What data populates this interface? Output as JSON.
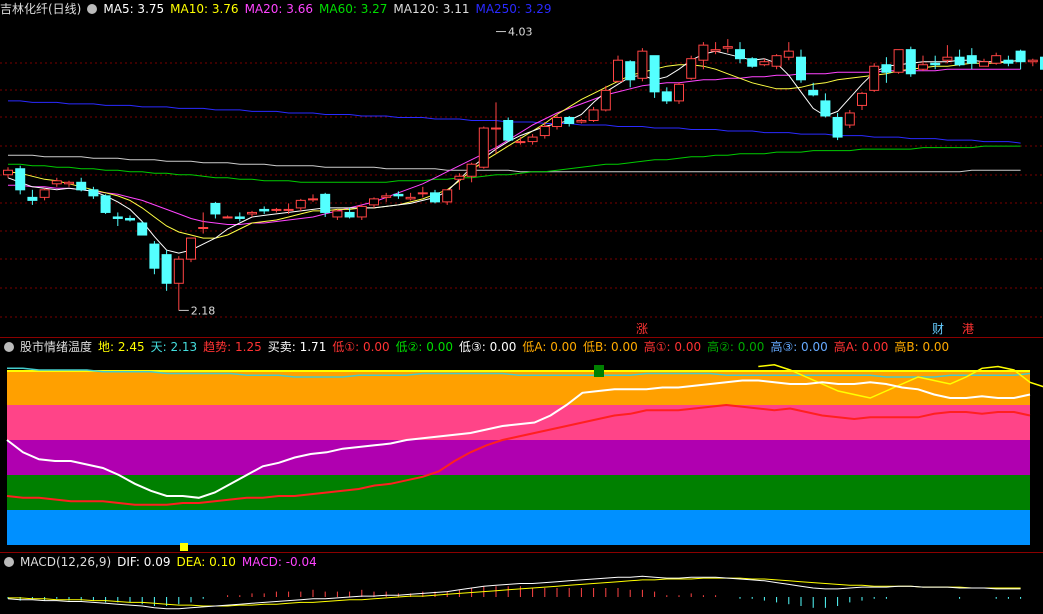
{
  "main": {
    "title": "吉林化纤(日线)",
    "ma": [
      {
        "label": "MA5: 3.75",
        "color": "#ffffff"
      },
      {
        "label": "MA10: 3.76",
        "color": "#ffff00"
      },
      {
        "label": "MA20: 3.66",
        "color": "#ff44ff"
      },
      {
        "label": "MA60: 3.27",
        "color": "#00dd00"
      },
      {
        "label": "MA120: 3.11",
        "color": "#dddddd"
      },
      {
        "label": "MA250: 3.29",
        "color": "#2a2aff"
      }
    ],
    "high_label": "4.03",
    "low_label": "2.18",
    "markers": [
      {
        "text": "涨",
        "color": "#ff3333"
      },
      {
        "text": "财",
        "color": "#66ccff"
      },
      {
        "text": "港",
        "color": "#ff3333"
      }
    ],
    "candles": [
      [
        3.08,
        3.13,
        3.06,
        3.11
      ],
      [
        3.12,
        3.14,
        2.95,
        2.98
      ],
      [
        2.93,
        2.98,
        2.88,
        2.91
      ],
      [
        2.93,
        2.99,
        2.91,
        2.98
      ],
      [
        3.02,
        3.06,
        3.0,
        3.04
      ],
      [
        3.02,
        3.04,
        3.0,
        3.03
      ],
      [
        3.03,
        3.06,
        2.97,
        2.98
      ],
      [
        2.98,
        3.0,
        2.92,
        2.94
      ],
      [
        2.94,
        2.95,
        2.82,
        2.83
      ],
      [
        2.8,
        2.83,
        2.74,
        2.79
      ],
      [
        2.79,
        2.81,
        2.77,
        2.78
      ],
      [
        2.76,
        2.77,
        2.68,
        2.68
      ],
      [
        2.62,
        2.64,
        2.42,
        2.46
      ],
      [
        2.55,
        2.58,
        2.31,
        2.36
      ],
      [
        2.36,
        2.54,
        2.18,
        2.52
      ],
      [
        2.52,
        2.66,
        2.5,
        2.66
      ],
      [
        2.73,
        2.83,
        2.69,
        2.73
      ],
      [
        2.89,
        2.9,
        2.79,
        2.82
      ],
      [
        2.8,
        2.81,
        2.79,
        2.8
      ],
      [
        2.8,
        2.83,
        2.77,
        2.79
      ],
      [
        2.82,
        2.84,
        2.8,
        2.83
      ],
      [
        2.85,
        2.87,
        2.82,
        2.84
      ],
      [
        2.85,
        2.86,
        2.83,
        2.85
      ],
      [
        2.85,
        2.89,
        2.82,
        2.85
      ],
      [
        2.86,
        2.92,
        2.84,
        2.91
      ],
      [
        2.92,
        2.95,
        2.9,
        2.92
      ],
      [
        2.95,
        2.96,
        2.8,
        2.83
      ],
      [
        2.8,
        2.85,
        2.78,
        2.84
      ],
      [
        2.83,
        2.86,
        2.79,
        2.8
      ],
      [
        2.8,
        2.88,
        2.78,
        2.87
      ],
      [
        2.88,
        2.93,
        2.86,
        2.92
      ],
      [
        2.93,
        2.96,
        2.9,
        2.94
      ],
      [
        2.95,
        2.97,
        2.92,
        2.94
      ],
      [
        2.92,
        2.96,
        2.91,
        2.93
      ],
      [
        2.96,
        3.0,
        2.93,
        2.96
      ],
      [
        2.96,
        2.98,
        2.89,
        2.9
      ],
      [
        2.9,
        2.98,
        2.88,
        2.98
      ],
      [
        3.05,
        3.09,
        2.98,
        3.07
      ],
      [
        3.07,
        3.16,
        3.03,
        3.15
      ],
      [
        3.13,
        3.4,
        3.12,
        3.39
      ],
      [
        3.39,
        3.56,
        3.22,
        3.39
      ],
      [
        3.44,
        3.46,
        3.3,
        3.31
      ],
      [
        3.3,
        3.33,
        3.28,
        3.3
      ],
      [
        3.3,
        3.35,
        3.28,
        3.33
      ],
      [
        3.34,
        3.43,
        3.32,
        3.4
      ],
      [
        3.4,
        3.48,
        3.38,
        3.46
      ],
      [
        3.46,
        3.47,
        3.4,
        3.42
      ],
      [
        3.43,
        3.45,
        3.42,
        3.44
      ],
      [
        3.44,
        3.53,
        3.43,
        3.51
      ],
      [
        3.51,
        3.67,
        3.5,
        3.64
      ],
      [
        3.7,
        3.87,
        3.69,
        3.84
      ],
      [
        3.83,
        3.84,
        3.66,
        3.71
      ],
      [
        3.72,
        3.92,
        3.7,
        3.9
      ],
      [
        3.87,
        3.87,
        3.59,
        3.63
      ],
      [
        3.63,
        3.66,
        3.55,
        3.57
      ],
      [
        3.57,
        3.69,
        3.55,
        3.68
      ],
      [
        3.72,
        3.87,
        3.71,
        3.85
      ],
      [
        3.84,
        3.96,
        3.78,
        3.94
      ],
      [
        3.9,
        3.96,
        3.88,
        3.91
      ],
      [
        3.92,
        3.98,
        3.89,
        3.93
      ],
      [
        3.91,
        3.96,
        3.82,
        3.85
      ],
      [
        3.85,
        3.86,
        3.79,
        3.8
      ],
      [
        3.81,
        3.85,
        3.8,
        3.83
      ],
      [
        3.8,
        3.88,
        3.78,
        3.87
      ],
      [
        3.86,
        3.96,
        3.84,
        3.9
      ],
      [
        3.86,
        3.91,
        3.69,
        3.71
      ],
      [
        3.64,
        3.69,
        3.6,
        3.61
      ],
      [
        3.57,
        3.62,
        3.46,
        3.47
      ],
      [
        3.46,
        3.49,
        3.31,
        3.33
      ],
      [
        3.41,
        3.51,
        3.39,
        3.49
      ],
      [
        3.54,
        3.63,
        3.51,
        3.62
      ],
      [
        3.64,
        3.82,
        3.63,
        3.8
      ],
      [
        3.81,
        3.86,
        3.69,
        3.76
      ],
      [
        3.76,
        3.91,
        3.75,
        3.91
      ],
      [
        3.91,
        3.93,
        3.73,
        3.75
      ],
      [
        3.78,
        3.87,
        3.77,
        3.81
      ],
      [
        3.82,
        3.87,
        3.78,
        3.81
      ],
      [
        3.84,
        3.94,
        3.82,
        3.86
      ],
      [
        3.86,
        3.91,
        3.8,
        3.81
      ],
      [
        3.87,
        3.92,
        3.78,
        3.82
      ],
      [
        3.8,
        3.85,
        3.8,
        3.83
      ],
      [
        3.82,
        3.89,
        3.81,
        3.87
      ],
      [
        3.84,
        3.87,
        3.8,
        3.82
      ],
      [
        3.9,
        3.91,
        3.78,
        3.83
      ],
      [
        3.83,
        3.85,
        3.8,
        3.84
      ],
      [
        3.86,
        3.86,
        3.71,
        3.78
      ]
    ],
    "ma5": [
      3.06,
      3.03,
      3.0,
      2.99,
      2.98,
      2.99,
      2.98,
      2.97,
      2.94,
      2.9,
      2.85,
      2.77,
      2.67,
      2.58,
      2.56,
      2.58,
      2.62,
      2.66,
      2.72,
      2.76,
      2.8,
      2.81,
      2.82,
      2.83,
      2.84,
      2.85,
      2.86,
      2.86,
      2.86,
      2.86,
      2.86,
      2.87,
      2.88,
      2.89,
      2.91,
      2.93,
      2.97,
      3.05,
      3.13,
      3.19,
      3.25,
      3.3,
      3.34,
      3.37,
      3.4,
      3.42,
      3.44,
      3.48,
      3.56,
      3.63,
      3.68,
      3.73,
      3.74,
      3.71,
      3.73,
      3.78,
      3.84,
      3.88,
      3.9,
      3.88,
      3.86,
      3.84,
      3.85,
      3.82,
      3.74,
      3.63,
      3.52,
      3.47,
      3.5,
      3.59,
      3.68,
      3.76,
      3.8,
      3.81,
      3.82,
      3.83,
      3.83,
      3.83,
      3.84,
      3.84,
      3.83,
      3.83,
      3.83,
      3.84
    ],
    "ma10": [
      3.1,
      3.09,
      3.07,
      3.05,
      3.04,
      3.02,
      3.0,
      2.98,
      2.96,
      2.94,
      2.91,
      2.86,
      2.8,
      2.74,
      2.7,
      2.68,
      2.66,
      2.66,
      2.68,
      2.72,
      2.76,
      2.77,
      2.78,
      2.8,
      2.82,
      2.84,
      2.84,
      2.85,
      2.85,
      2.86,
      2.86,
      2.87,
      2.88,
      2.9,
      2.92,
      2.95,
      2.98,
      3.04,
      3.11,
      3.17,
      3.22,
      3.27,
      3.32,
      3.37,
      3.42,
      3.48,
      3.53,
      3.58,
      3.62,
      3.66,
      3.7,
      3.74,
      3.76,
      3.78,
      3.8,
      3.81,
      3.81,
      3.8,
      3.78,
      3.75,
      3.72,
      3.69,
      3.67,
      3.65,
      3.65,
      3.66,
      3.68,
      3.69,
      3.71,
      3.72,
      3.73,
      3.74,
      3.75,
      3.77,
      3.78,
      3.79,
      3.8,
      3.8,
      3.81,
      3.82,
      3.82,
      3.82,
      3.83,
      3.84
    ],
    "ma20": [
      3.01,
      3.01,
      3.0,
      3.0,
      2.99,
      2.99,
      2.98,
      2.97,
      2.96,
      2.95,
      2.93,
      2.91,
      2.88,
      2.85,
      2.82,
      2.79,
      2.77,
      2.76,
      2.75,
      2.75,
      2.76,
      2.76,
      2.77,
      2.78,
      2.79,
      2.8,
      2.82,
      2.84,
      2.86,
      2.88,
      2.9,
      2.93,
      2.96,
      2.99,
      3.02,
      3.06,
      3.1,
      3.14,
      3.18,
      3.22,
      3.26,
      3.31,
      3.36,
      3.41,
      3.45,
      3.49,
      3.52,
      3.55,
      3.58,
      3.61,
      3.63,
      3.65,
      3.67,
      3.68,
      3.69,
      3.69,
      3.7,
      3.71,
      3.71,
      3.72,
      3.72,
      3.73,
      3.73,
      3.74,
      3.74,
      3.75,
      3.75,
      3.75,
      3.76,
      3.76,
      3.76,
      3.76,
      3.77,
      3.77,
      3.77,
      3.77,
      3.77,
      3.78,
      3.78,
      3.78,
      3.78,
      3.78,
      3.78,
      3.78
    ],
    "ma60": [
      3.15,
      3.15,
      3.14,
      3.14,
      3.13,
      3.13,
      3.12,
      3.12,
      3.11,
      3.11,
      3.1,
      3.1,
      3.09,
      3.09,
      3.08,
      3.08,
      3.07,
      3.06,
      3.06,
      3.05,
      3.05,
      3.04,
      3.04,
      3.04,
      3.03,
      3.03,
      3.03,
      3.03,
      3.03,
      3.03,
      3.03,
      3.03,
      3.04,
      3.04,
      3.04,
      3.05,
      3.05,
      3.06,
      3.06,
      3.07,
      3.08,
      3.08,
      3.09,
      3.1,
      3.1,
      3.11,
      3.12,
      3.13,
      3.14,
      3.15,
      3.15,
      3.16,
      3.17,
      3.18,
      3.18,
      3.19,
      3.2,
      3.2,
      3.21,
      3.21,
      3.22,
      3.22,
      3.22,
      3.23,
      3.23,
      3.23,
      3.24,
      3.24,
      3.24,
      3.24,
      3.25,
      3.25,
      3.25,
      3.25,
      3.25,
      3.26,
      3.26,
      3.26,
      3.26,
      3.26,
      3.27,
      3.27,
      3.27,
      3.27
    ],
    "ma120": [
      3.21,
      3.21,
      3.21,
      3.2,
      3.2,
      3.2,
      3.2,
      3.19,
      3.19,
      3.19,
      3.18,
      3.18,
      3.18,
      3.17,
      3.17,
      3.17,
      3.16,
      3.16,
      3.16,
      3.15,
      3.15,
      3.15,
      3.14,
      3.14,
      3.14,
      3.14,
      3.13,
      3.13,
      3.13,
      3.13,
      3.13,
      3.12,
      3.12,
      3.12,
      3.12,
      3.12,
      3.11,
      3.11,
      3.11,
      3.11,
      3.11,
      3.11,
      3.1,
      3.1,
      3.1,
      3.1,
      3.1,
      3.1,
      3.1,
      3.1,
      3.1,
      3.1,
      3.1,
      3.1,
      3.1,
      3.1,
      3.1,
      3.1,
      3.1,
      3.1,
      3.1,
      3.1,
      3.1,
      3.1,
      3.1,
      3.1,
      3.1,
      3.1,
      3.1,
      3.1,
      3.1,
      3.1,
      3.1,
      3.1,
      3.1,
      3.1,
      3.1,
      3.1,
      3.1,
      3.11,
      3.11,
      3.11,
      3.11,
      3.11
    ],
    "ma250": [
      3.57,
      3.57,
      3.56,
      3.56,
      3.56,
      3.55,
      3.55,
      3.55,
      3.54,
      3.54,
      3.54,
      3.53,
      3.53,
      3.53,
      3.52,
      3.52,
      3.52,
      3.51,
      3.51,
      3.51,
      3.5,
      3.5,
      3.5,
      3.49,
      3.49,
      3.49,
      3.48,
      3.48,
      3.48,
      3.47,
      3.47,
      3.47,
      3.46,
      3.46,
      3.46,
      3.45,
      3.45,
      3.45,
      3.44,
      3.44,
      3.44,
      3.43,
      3.43,
      3.43,
      3.42,
      3.42,
      3.42,
      3.41,
      3.41,
      3.41,
      3.4,
      3.4,
      3.4,
      3.39,
      3.39,
      3.39,
      3.38,
      3.38,
      3.38,
      3.37,
      3.37,
      3.37,
      3.36,
      3.36,
      3.36,
      3.35,
      3.35,
      3.35,
      3.34,
      3.34,
      3.34,
      3.33,
      3.33,
      3.33,
      3.32,
      3.32,
      3.32,
      3.31,
      3.31,
      3.31,
      3.3,
      3.3,
      3.3,
      3.29
    ]
  },
  "sentiment": {
    "title": "股市情绪温度",
    "values": [
      {
        "label": "地: 2.45",
        "color": "#ffff00"
      },
      {
        "label": "天: 2.13",
        "color": "#44dddd"
      },
      {
        "label": "趋势: 1.25",
        "color": "#ff3333"
      },
      {
        "label": "买卖: 1.71",
        "color": "#ffffff"
      },
      {
        "label": "低①: 0.00",
        "color": "#ff3333"
      },
      {
        "label": "低②: 0.00",
        "color": "#00dd00"
      },
      {
        "label": "低③: 0.00",
        "color": "#ffffff"
      },
      {
        "label": "低A: 0.00",
        "color": "#ffaa00"
      },
      {
        "label": "低B: 0.00",
        "color": "#ffaa00"
      },
      {
        "label": "高①: 0.00",
        "color": "#ff3333"
      },
      {
        "label": "高②: 0.00",
        "color": "#00aa00"
      },
      {
        "label": "高③: 0.00",
        "color": "#66aaff"
      },
      {
        "label": "高A: 0.00",
        "color": "#ff3333"
      },
      {
        "label": "高B: 0.00",
        "color": "#ffaa00"
      }
    ],
    "bands": [
      "#ffa000",
      "#ff4488",
      "#b000b0",
      "#008000",
      "#0090ff"
    ],
    "white": [
      60,
      53,
      49,
      48,
      48,
      46,
      44,
      40,
      35,
      31,
      28,
      28,
      27,
      30,
      35,
      40,
      45,
      47,
      50,
      52,
      53,
      55,
      56,
      57,
      58,
      60,
      61,
      62,
      63,
      64,
      66,
      68,
      69,
      70,
      74,
      80,
      87,
      88,
      89,
      89,
      89,
      90,
      90,
      91,
      92,
      93,
      94,
      94,
      93,
      92,
      92,
      93,
      92,
      92,
      93,
      92,
      90,
      89,
      86,
      84,
      84,
      85,
      84,
      84,
      86
    ],
    "red": [
      28,
      27,
      27,
      26,
      25,
      25,
      25,
      24,
      23,
      23,
      23,
      24,
      24,
      25,
      26,
      27,
      27,
      28,
      28,
      29,
      30,
      31,
      32,
      34,
      35,
      37,
      39,
      42,
      48,
      53,
      57,
      60,
      62,
      64,
      66,
      68,
      70,
      72,
      74,
      75,
      77,
      77,
      77,
      78,
      79,
      80,
      79,
      78,
      77,
      78,
      76,
      74,
      73,
      72,
      73,
      73,
      73,
      73,
      75,
      76,
      76,
      75,
      76,
      76,
      74
    ],
    "yellow_start": 47,
    "yellow": [
      102,
      103,
      100,
      96,
      92,
      88,
      86,
      84,
      88,
      92,
      96,
      94,
      92,
      96,
      101,
      102,
      100,
      93,
      90,
      92,
      94,
      91,
      92,
      95,
      96,
      97,
      101
    ],
    "teal": [
      101,
      101,
      100,
      100,
      100,
      100,
      99,
      99,
      99,
      99,
      98,
      98,
      98,
      98,
      98,
      97,
      97,
      97,
      96,
      96,
      96,
      96,
      97,
      97,
      97,
      97,
      98,
      98,
      98,
      98,
      98,
      98,
      97,
      97,
      97,
      97,
      97,
      97,
      97,
      97,
      98,
      98,
      98,
      98,
      98,
      97,
      97,
      97,
      97,
      97,
      97,
      97,
      97,
      97,
      97,
      96,
      96,
      96,
      96,
      97,
      97,
      97,
      97,
      97,
      98
    ]
  },
  "macd": {
    "title": "MACD(12,26,9)",
    "values": [
      {
        "label": "DIF: 0.09",
        "color": "#ffffff"
      },
      {
        "label": "DEA: 0.10",
        "color": "#ffff00"
      },
      {
        "label": "MACD: -0.04",
        "color": "#ff44ff"
      }
    ],
    "dif": [
      -0.02,
      -0.03,
      -0.03,
      -0.04,
      -0.04,
      -0.05,
      -0.05,
      -0.06,
      -0.07,
      -0.08,
      -0.09,
      -0.1,
      -0.12,
      -0.13,
      -0.13,
      -0.12,
      -0.11,
      -0.1,
      -0.09,
      -0.08,
      -0.07,
      -0.06,
      -0.05,
      -0.04,
      -0.03,
      -0.02,
      -0.02,
      -0.01,
      0.0,
      0.01,
      0.01,
      0.02,
      0.02,
      0.03,
      0.04,
      0.05,
      0.06,
      0.08,
      0.1,
      0.12,
      0.13,
      0.14,
      0.15,
      0.15,
      0.16,
      0.17,
      0.18,
      0.19,
      0.2,
      0.21,
      0.22,
      0.22,
      0.23,
      0.22,
      0.21,
      0.21,
      0.22,
      0.22,
      0.22,
      0.21,
      0.2,
      0.19,
      0.18,
      0.16,
      0.14,
      0.12,
      0.1,
      0.09,
      0.09,
      0.1,
      0.11,
      0.11,
      0.11,
      0.12,
      0.12,
      0.11,
      0.11,
      0.11,
      0.1,
      0.1,
      0.1,
      0.09,
      0.09,
      0.09
    ],
    "dea": [
      -0.01,
      -0.01,
      -0.02,
      -0.02,
      -0.03,
      -0.03,
      -0.03,
      -0.04,
      -0.04,
      -0.05,
      -0.06,
      -0.06,
      -0.07,
      -0.08,
      -0.09,
      -0.09,
      -0.1,
      -0.1,
      -0.1,
      -0.09,
      -0.09,
      -0.08,
      -0.08,
      -0.07,
      -0.06,
      -0.06,
      -0.05,
      -0.04,
      -0.03,
      -0.03,
      -0.02,
      -0.01,
      0.0,
      0.01,
      0.01,
      0.02,
      0.03,
      0.04,
      0.05,
      0.06,
      0.07,
      0.08,
      0.09,
      0.1,
      0.11,
      0.12,
      0.13,
      0.14,
      0.15,
      0.16,
      0.17,
      0.18,
      0.19,
      0.19,
      0.2,
      0.2,
      0.2,
      0.21,
      0.21,
      0.21,
      0.21,
      0.2,
      0.2,
      0.19,
      0.18,
      0.17,
      0.16,
      0.15,
      0.14,
      0.13,
      0.13,
      0.12,
      0.12,
      0.12,
      0.12,
      0.11,
      0.11,
      0.11,
      0.11,
      0.1,
      0.1,
      0.1,
      0.1,
      0.1
    ]
  }
}
